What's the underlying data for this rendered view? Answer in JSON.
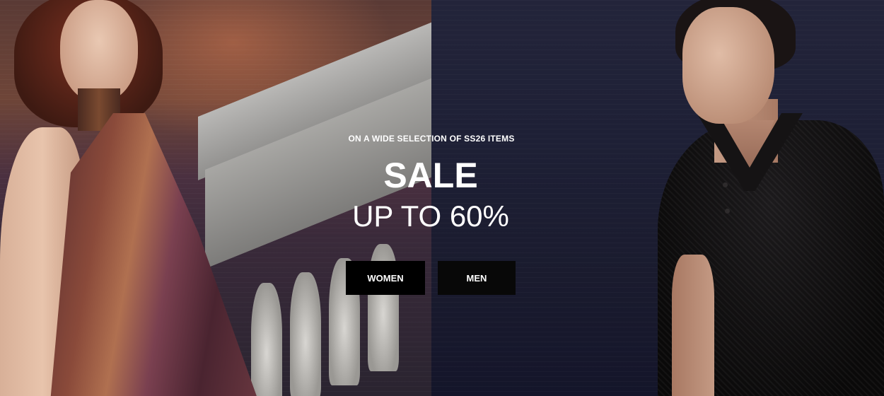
{
  "hero": {
    "eyebrow": "ON A WIDE SELECTION OF SS26 ITEMS",
    "headline": "SALE",
    "subline": "UP TO 60%",
    "buttons": {
      "women": "WOMEN",
      "men": "MEN"
    },
    "images": {
      "left": "woman-model-photo",
      "right": "man-model-photo"
    },
    "colors": {
      "button_bg": "#000000",
      "text": "#ffffff"
    }
  }
}
